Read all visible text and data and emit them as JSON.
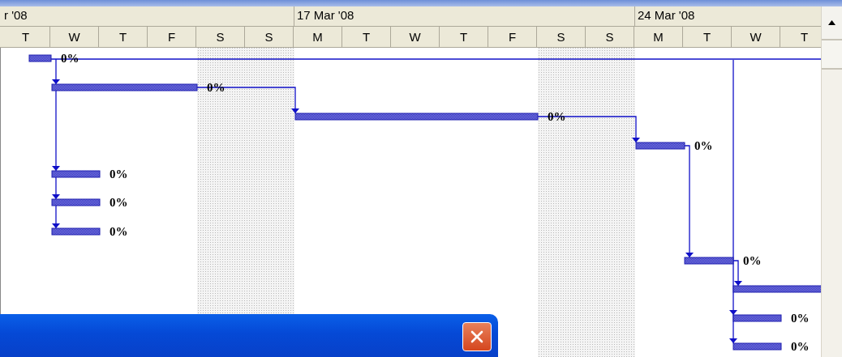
{
  "timescale": {
    "weeks": [
      {
        "label": "r '08",
        "days": [
          {
            "letter": "T",
            "nonworking": false
          },
          {
            "letter": "W",
            "nonworking": false
          },
          {
            "letter": "T",
            "nonworking": false
          },
          {
            "letter": "F",
            "nonworking": false
          },
          {
            "letter": "S",
            "nonworking": true
          },
          {
            "letter": "S",
            "nonworking": true
          }
        ]
      },
      {
        "label": "17 Mar '08",
        "days": [
          {
            "letter": "M",
            "nonworking": false
          },
          {
            "letter": "T",
            "nonworking": false
          },
          {
            "letter": "W",
            "nonworking": false
          },
          {
            "letter": "T",
            "nonworking": false
          },
          {
            "letter": "F",
            "nonworking": false
          },
          {
            "letter": "S",
            "nonworking": true
          },
          {
            "letter": "S",
            "nonworking": true
          }
        ]
      },
      {
        "label": "24 Mar '08",
        "days": [
          {
            "letter": "M",
            "nonworking": false
          },
          {
            "letter": "T",
            "nonworking": false
          },
          {
            "letter": "W",
            "nonworking": false
          },
          {
            "letter": "T",
            "nonworking": false
          }
        ]
      }
    ]
  },
  "tasks": [
    {
      "kind": "task",
      "progress": "0%"
    },
    {
      "kind": "task",
      "progress": "0%"
    },
    {
      "kind": "task",
      "progress": "0%"
    },
    {
      "kind": "task",
      "progress": "0%"
    },
    {
      "kind": "task",
      "progress": "0%"
    },
    {
      "kind": "task",
      "progress": "0%"
    },
    {
      "kind": "task",
      "progress": "0%"
    },
    {
      "kind": "task",
      "progress": "0%"
    },
    {
      "kind": "task"
    },
    {
      "kind": "task",
      "progress": "0%"
    },
    {
      "kind": "task",
      "progress": "0%"
    }
  ],
  "dialog": {
    "close_button": true
  }
}
